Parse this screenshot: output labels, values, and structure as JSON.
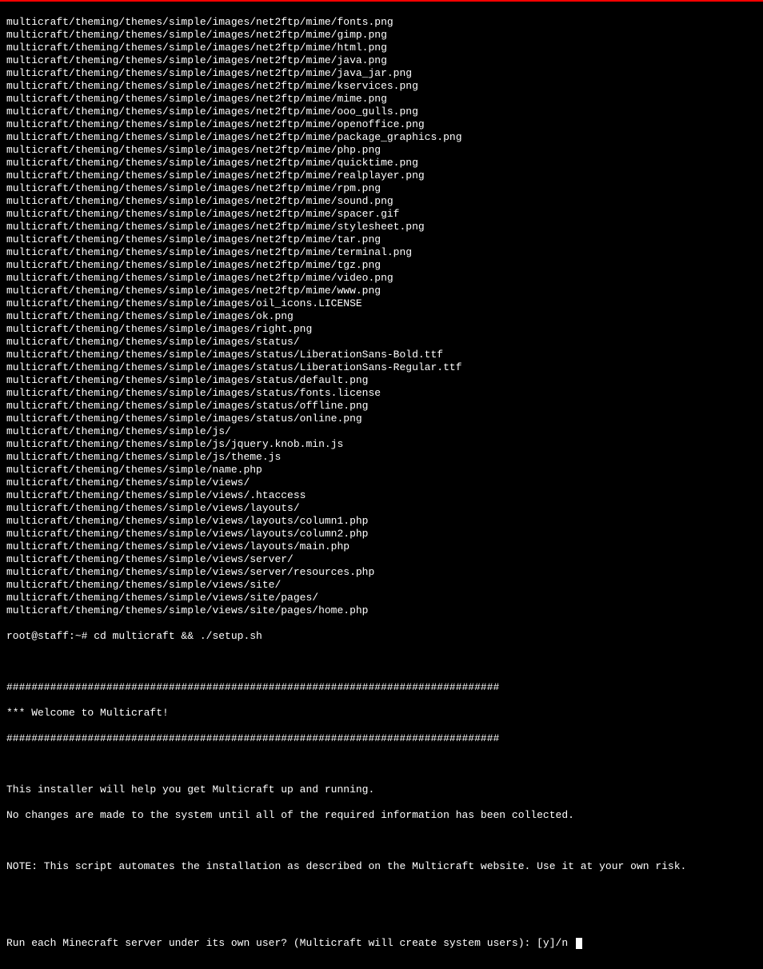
{
  "file_listing": [
    "multicraft/theming/themes/simple/images/net2ftp/mime/fonts.png",
    "multicraft/theming/themes/simple/images/net2ftp/mime/gimp.png",
    "multicraft/theming/themes/simple/images/net2ftp/mime/html.png",
    "multicraft/theming/themes/simple/images/net2ftp/mime/java.png",
    "multicraft/theming/themes/simple/images/net2ftp/mime/java_jar.png",
    "multicraft/theming/themes/simple/images/net2ftp/mime/kservices.png",
    "multicraft/theming/themes/simple/images/net2ftp/mime/mime.png",
    "multicraft/theming/themes/simple/images/net2ftp/mime/ooo_gulls.png",
    "multicraft/theming/themes/simple/images/net2ftp/mime/openoffice.png",
    "multicraft/theming/themes/simple/images/net2ftp/mime/package_graphics.png",
    "multicraft/theming/themes/simple/images/net2ftp/mime/php.png",
    "multicraft/theming/themes/simple/images/net2ftp/mime/quicktime.png",
    "multicraft/theming/themes/simple/images/net2ftp/mime/realplayer.png",
    "multicraft/theming/themes/simple/images/net2ftp/mime/rpm.png",
    "multicraft/theming/themes/simple/images/net2ftp/mime/sound.png",
    "multicraft/theming/themes/simple/images/net2ftp/mime/spacer.gif",
    "multicraft/theming/themes/simple/images/net2ftp/mime/stylesheet.png",
    "multicraft/theming/themes/simple/images/net2ftp/mime/tar.png",
    "multicraft/theming/themes/simple/images/net2ftp/mime/terminal.png",
    "multicraft/theming/themes/simple/images/net2ftp/mime/tgz.png",
    "multicraft/theming/themes/simple/images/net2ftp/mime/video.png",
    "multicraft/theming/themes/simple/images/net2ftp/mime/www.png",
    "multicraft/theming/themes/simple/images/oil_icons.LICENSE",
    "multicraft/theming/themes/simple/images/ok.png",
    "multicraft/theming/themes/simple/images/right.png",
    "multicraft/theming/themes/simple/images/status/",
    "multicraft/theming/themes/simple/images/status/LiberationSans-Bold.ttf",
    "multicraft/theming/themes/simple/images/status/LiberationSans-Regular.ttf",
    "multicraft/theming/themes/simple/images/status/default.png",
    "multicraft/theming/themes/simple/images/status/fonts.license",
    "multicraft/theming/themes/simple/images/status/offline.png",
    "multicraft/theming/themes/simple/images/status/online.png",
    "multicraft/theming/themes/simple/js/",
    "multicraft/theming/themes/simple/js/jquery.knob.min.js",
    "multicraft/theming/themes/simple/js/theme.js",
    "multicraft/theming/themes/simple/name.php",
    "multicraft/theming/themes/simple/views/",
    "multicraft/theming/themes/simple/views/.htaccess",
    "multicraft/theming/themes/simple/views/layouts/",
    "multicraft/theming/themes/simple/views/layouts/column1.php",
    "multicraft/theming/themes/simple/views/layouts/column2.php",
    "multicraft/theming/themes/simple/views/layouts/main.php",
    "multicraft/theming/themes/simple/views/server/",
    "multicraft/theming/themes/simple/views/server/resources.php",
    "multicraft/theming/themes/simple/views/site/",
    "multicraft/theming/themes/simple/views/site/pages/",
    "multicraft/theming/themes/simple/views/site/pages/home.php"
  ],
  "prompt": {
    "text": "root@staff:~# ",
    "command": "cd multicraft && ./setup.sh"
  },
  "installer": {
    "separator": "###############################################################################",
    "welcome": "*** Welcome to Multicraft!",
    "line1": "This installer will help you get Multicraft up and running.",
    "line2": "No changes are made to the system until all of the required information has been collected.",
    "note": "NOTE: This script automates the installation as described on the Multicraft website. Use it at your own risk.",
    "question": "Run each Minecraft server under its own user? (Multicraft will create system users): [y]/n "
  }
}
